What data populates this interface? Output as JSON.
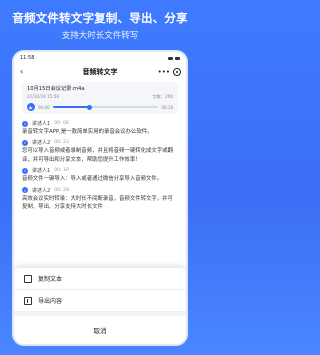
{
  "promo": {
    "title": "音频文件转文字复制、导出、分享",
    "subtitle": "支持大时长文件转写"
  },
  "status": {
    "time": "11:58"
  },
  "appbar": {
    "title": "音频转文字",
    "back_icon": "chevron-left-icon",
    "more_icon": "more-horizontal-icon",
    "target_icon": "record-icon"
  },
  "file": {
    "name": "10月15日会议记录.m4a",
    "date": "21/10/29 15:50",
    "size": "字数：200",
    "current": "00:00",
    "duration": "00:16",
    "progress": 0.35
  },
  "transcript": [
    {
      "speaker": "讲述人1",
      "time": "00: 06",
      "text": "录音转文字APP,是一款简单实用的录音会议办公软件。"
    },
    {
      "speaker": "讲述人2",
      "time": "00: 23",
      "text": "您可以导入音频或者录制音频，并且将音频一键转化成文字或翻译，并可导出和分享文本，帮助您提升工作效率！"
    },
    {
      "speaker": "讲述人1",
      "time": "00: 10",
      "text": "音频文件一键导入：导入或者通过微信分享导入音频文件。"
    },
    {
      "speaker": "讲述人2",
      "time": "00: 28",
      "text": "高效会议实时转录：大时长不间断录音，音频文件转文字，并可复制、导出、分享支持大时长文件"
    }
  ],
  "sheet": {
    "copy_label": "复制文本",
    "export_label": "导出内容",
    "cancel_label": "取消"
  },
  "colors": {
    "accent": "#3b6ff5",
    "background": "#3f7bff"
  }
}
